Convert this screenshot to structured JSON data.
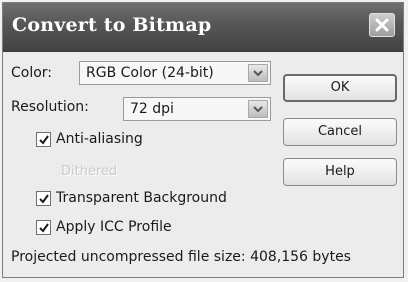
{
  "dialog": {
    "title": "Convert to Bitmap"
  },
  "color": {
    "label": "Color:",
    "value": "RGB Color (24-bit)"
  },
  "resolution": {
    "label": "Resolution:",
    "value": "72 dpi"
  },
  "options": {
    "anti_aliasing": {
      "label": "Anti-aliasing",
      "checked": true
    },
    "dithered": {
      "label": "Dithered",
      "enabled": false
    },
    "transparent_background": {
      "label": "Transparent Background",
      "checked": true
    },
    "apply_icc_profile": {
      "label": "Apply ICC Profile",
      "checked": true
    }
  },
  "buttons": {
    "ok": "OK",
    "cancel": "Cancel",
    "help": "Help"
  },
  "footer": {
    "file_size_text": "Projected uncompressed file size: 408,156 bytes"
  },
  "icons": {
    "close": "close-icon",
    "dropdown": "chevron-down-icon",
    "check": "checkmark-icon"
  },
  "colors": {
    "titlebar": "#565656",
    "dialog_bg": "#ececec",
    "disabled_text": "#c9c9c9"
  }
}
